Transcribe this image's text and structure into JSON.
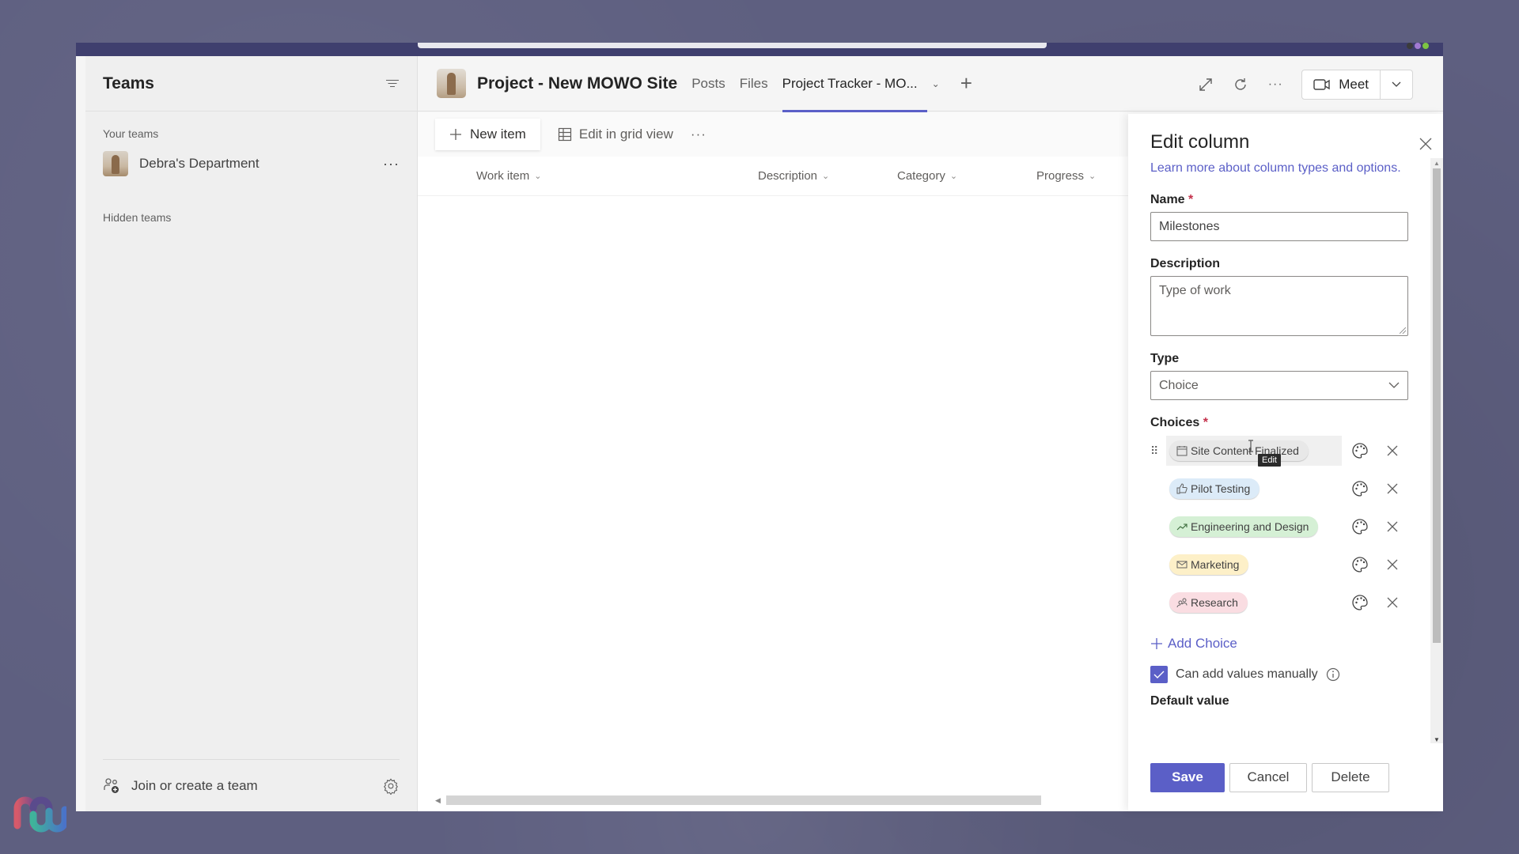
{
  "window": {
    "titlebar_status_colors": [
      "#3b3b3b",
      "#a27ad3",
      "#7dc542"
    ]
  },
  "sidebar": {
    "title": "Teams",
    "filter_icon": "filter-icon",
    "your_teams_label": "Your teams",
    "teams": [
      {
        "name": "Debra's Department",
        "more": "···"
      }
    ],
    "hidden_teams_label": "Hidden teams",
    "footer": {
      "join_label": "Join or create a team",
      "join_icon": "people-add-icon",
      "settings_icon": "gear-icon"
    }
  },
  "channel": {
    "title": "Project - New MOWO Site",
    "tabs": [
      {
        "label": "Posts",
        "active": false
      },
      {
        "label": "Files",
        "active": false
      },
      {
        "label": "Project Tracker - MO...",
        "active": true
      }
    ],
    "add_tab": "+",
    "actions": {
      "expand_icon": "expand-icon",
      "refresh_icon": "refresh-icon",
      "more": "···",
      "meet_label": "Meet"
    }
  },
  "list": {
    "toolbar": {
      "new_item": "New item",
      "edit_grid": "Edit in grid view",
      "more": "···"
    },
    "columns": [
      "Work item",
      "Description",
      "Category",
      "Progress"
    ]
  },
  "edit_panel": {
    "title": "Edit column",
    "learn_more": "Learn more about column types and options.",
    "name_label": "Name",
    "required_mark": "*",
    "name_value": "Milestones",
    "description_label": "Description",
    "description_value": "Type of work",
    "type_label": "Type",
    "type_value": "Choice",
    "choices_label": "Choices",
    "choices": [
      {
        "label": "Site Content Finalized",
        "icon": "calendar-icon",
        "color": "#e8e8e8"
      },
      {
        "label": "Pilot Testing",
        "icon": "thumbs-up-icon",
        "color": "#dcebf8"
      },
      {
        "label": "Engineering and Design",
        "icon": "trending-up-icon",
        "color": "#d5f0d5"
      },
      {
        "label": "Marketing",
        "icon": "mail-icon",
        "color": "#fdf0c8"
      },
      {
        "label": "Research",
        "icon": "people-icon",
        "color": "#fadde2"
      }
    ],
    "tooltip": "Edit",
    "add_choice": "Add Choice",
    "can_add_manually_label": "Can add values manually",
    "can_add_manually_checked": true,
    "default_value_label": "Default value",
    "buttons": {
      "save": "Save",
      "cancel": "Cancel",
      "delete": "Delete"
    }
  },
  "colors": {
    "accent": "#5b5fc7",
    "titlebar": "#3f3f6e",
    "required": "#c4314b"
  }
}
